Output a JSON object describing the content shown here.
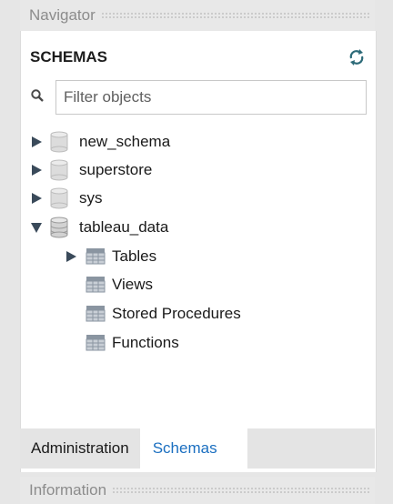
{
  "navigator": {
    "title": "Navigator"
  },
  "schemas": {
    "title": "SCHEMAS"
  },
  "filter": {
    "placeholder": "Filter objects"
  },
  "tree": {
    "schemas": [
      {
        "label": "new_schema",
        "expanded": false
      },
      {
        "label": "superstore",
        "expanded": false
      },
      {
        "label": "sys",
        "expanded": false
      },
      {
        "label": "tableau_data",
        "expanded": true
      }
    ],
    "children": [
      {
        "label": "Tables",
        "expandable": true
      },
      {
        "label": "Views",
        "expandable": false
      },
      {
        "label": "Stored Procedures",
        "expandable": false
      },
      {
        "label": "Functions",
        "expandable": false
      }
    ]
  },
  "tabs": {
    "administration": "Administration",
    "schemas": "Schemas"
  },
  "information": {
    "title": "Information"
  },
  "icons": {
    "refresh": "refresh-icon",
    "search": "search-icon",
    "expand": "triangle-right-icon",
    "collapse": "triangle-down-icon",
    "database": "database-icon",
    "folder": "folder-table-icon"
  },
  "colors": {
    "active_tab": "#1b6fc0",
    "arrow": "#3a4a5a",
    "refresh": "#2c6a78"
  }
}
